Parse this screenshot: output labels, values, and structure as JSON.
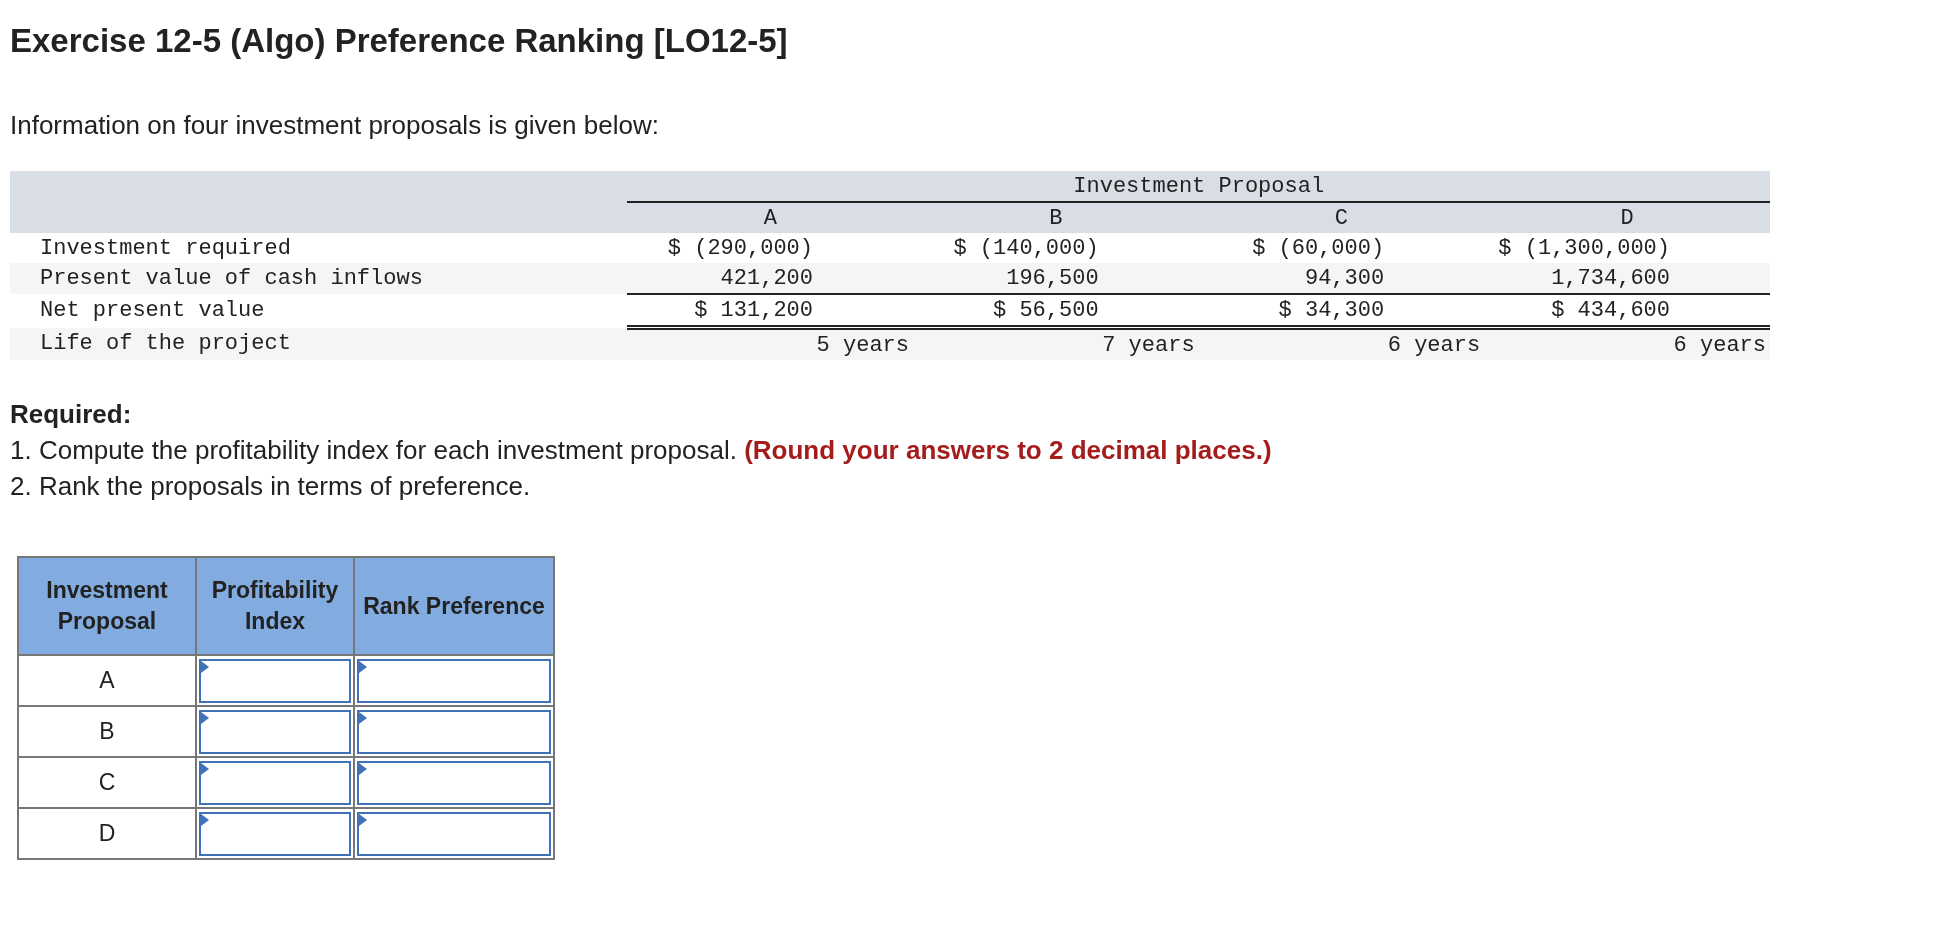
{
  "title": "Exercise 12-5 (Algo) Preference Ranking [LO12-5]",
  "intro": "Information on four investment proposals is given below:",
  "data_table": {
    "group_heading": "Investment Proposal",
    "columns": [
      "A",
      "B",
      "C",
      "D"
    ],
    "rows": [
      {
        "label": "Investment required",
        "kind": "money",
        "cells": [
          "$ (290,000)",
          "$ (140,000)",
          "$ (60,000)",
          "$ (1,300,000)"
        ]
      },
      {
        "label": "Present value of cash inflows",
        "kind": "subtotal",
        "cells": [
          "421,200",
          "196,500",
          "94,300",
          "1,734,600"
        ]
      },
      {
        "label": "Net present value",
        "kind": "total",
        "cells": [
          "$ 131,200",
          "$ 56,500",
          "$ 34,300",
          "$ 434,600"
        ]
      },
      {
        "label": "Life of the project",
        "kind": "life",
        "cells": [
          "5 years",
          "7 years",
          "6 years",
          "6 years"
        ]
      }
    ]
  },
  "required": {
    "heading": "Required:",
    "items": [
      "1. Compute the profitability index for each investment proposal. **(Round your answers to 2 decimal places.)**",
      "2. Rank the proposals in terms of preference."
    ]
  },
  "answer_table": {
    "columns": [
      "Investment Proposal",
      "Profitability Index",
      "Rank Preference"
    ],
    "rows": [
      {
        "proposal": "A"
      },
      {
        "proposal": "B"
      },
      {
        "proposal": "C"
      },
      {
        "proposal": "D"
      }
    ]
  }
}
